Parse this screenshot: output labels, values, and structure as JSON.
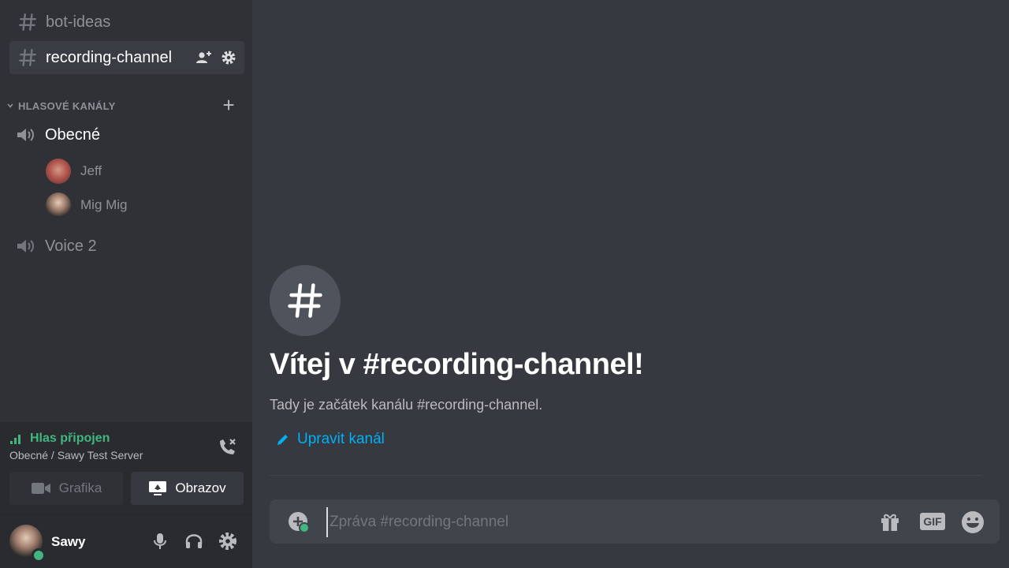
{
  "sidebar": {
    "text_channels": [
      {
        "name": "bot-ideas",
        "active": false
      },
      {
        "name": "recording-channel",
        "active": true
      }
    ],
    "voice_category": {
      "label": "HLASOVÉ KANÁLY",
      "add_label": "+"
    },
    "voice_channels": [
      {
        "name": "Obecné",
        "connected": true,
        "users": [
          {
            "name": "Jeff"
          },
          {
            "name": "Mig Mig"
          }
        ]
      },
      {
        "name": "Voice 2",
        "connected": false,
        "users": []
      }
    ]
  },
  "voice_panel": {
    "status": "Hlas připojen",
    "location": "Obecné / Sawy Test Server",
    "video_label": "Grafika",
    "screen_label": "Obrazov"
  },
  "user_panel": {
    "username": "Sawy",
    "status_color": "#43b581"
  },
  "main": {
    "welcome_title": "Vítej v #recording-channel!",
    "welcome_subtitle": "Tady je začátek kanálu #recording-channel.",
    "edit_channel_label": "Upravit kanál",
    "composer_placeholder": "Zpráva #recording-channel",
    "gif_label": "GIF"
  },
  "colors": {
    "accent_link": "#00b0f4",
    "voice_connected": "#43b581"
  }
}
